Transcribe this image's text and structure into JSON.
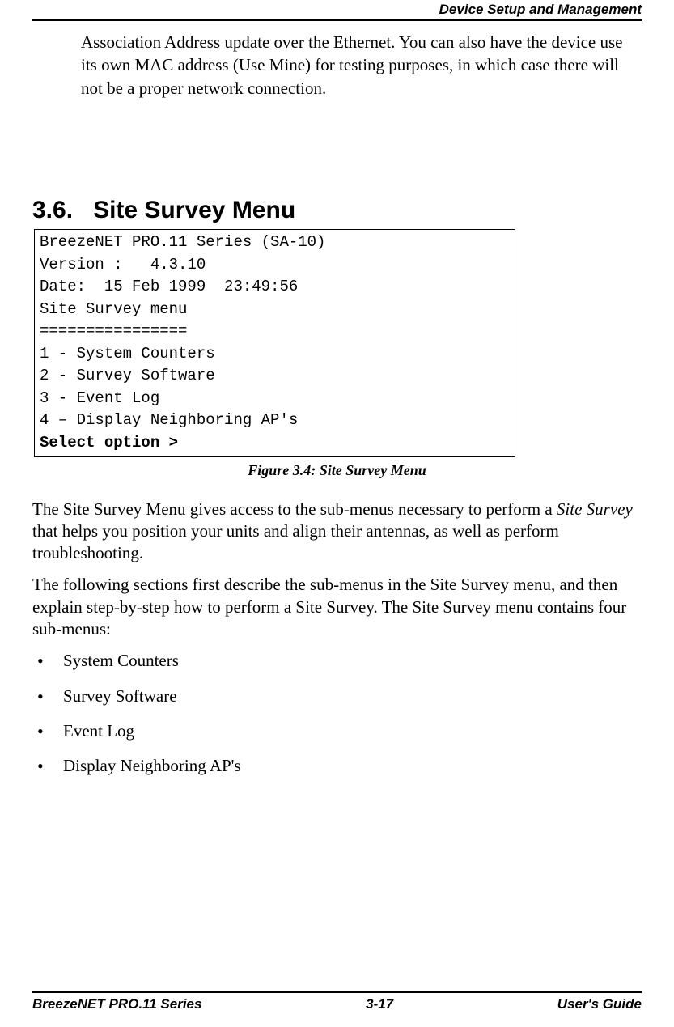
{
  "header": {
    "title": "Device Setup and Management"
  },
  "cont_paragraph": "Association Address update over the Ethernet. You can also have the device use its own MAC address (Use Mine) for testing purposes, in which case there will not be a proper network connection.",
  "section": {
    "number": "3.6.",
    "title": "Site Survey Menu"
  },
  "code": {
    "line1": "BreezeNET PRO.11 Series (SA-10)",
    "line2": "Version :   4.3.10",
    "line3": "Date:  15 Feb 1999  23:49:56",
    "line4": "",
    "line5": "Site Survey menu",
    "line6": "================",
    "line7": "1 - System Counters",
    "line8": "2 - Survey Software",
    "line9": "3 - Event Log",
    "line10": "4 – Display Neighboring AP's",
    "line11": "",
    "line12": "Select option >"
  },
  "figure_caption": "Figure 3.4:    Site Survey Menu",
  "para1_a": "The Site Survey Menu gives access to the sub-menus necessary to perform a ",
  "para1_b": "Site Survey",
  "para1_c": " that helps you position your units and align their antennas, as well as perform troubleshooting.",
  "para2": "The following sections first describe the sub-menus in the Site Survey menu, and then explain step-by-step how to perform a Site Survey. The Site Survey menu contains four sub-menus:",
  "bullets": {
    "b1": "System Counters",
    "b2": "Survey Software",
    "b3": "Event Log",
    "b4": "Display Neighboring AP's"
  },
  "footer": {
    "left": "BreezeNET PRO.11 Series",
    "center": "3-17",
    "right": "User's Guide"
  }
}
